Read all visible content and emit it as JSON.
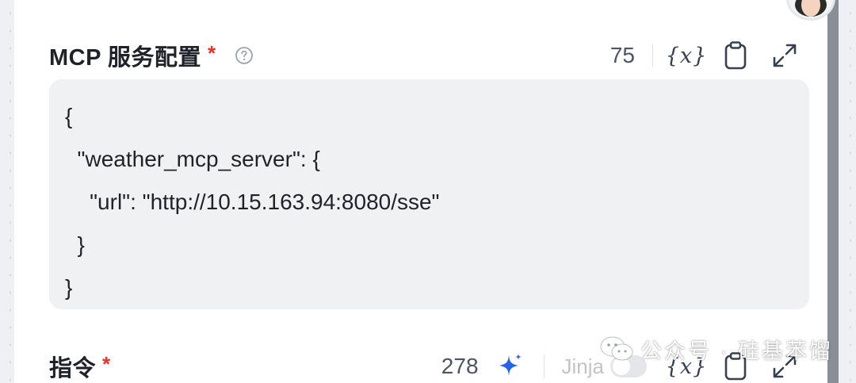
{
  "mcp_field": {
    "label": "MCP 服务配置",
    "required_mark": "*",
    "help_icon": "question-circle-icon",
    "char_count": "75",
    "tools": [
      "variable-icon",
      "clipboard-icon",
      "expand-icon"
    ],
    "code": "{\n  \"weather_mcp_server\": {\n    \"url\": \"http://10.15.163.94:8080/sse\"\n  }\n}"
  },
  "instruction_field": {
    "label": "指令",
    "required_mark": "*",
    "char_count": "278",
    "ai_icon": "sparkle-icon",
    "jinja_label": "Jinja",
    "jinja_enabled": false,
    "tools": [
      "variable-icon",
      "clipboard-icon",
      "expand-icon"
    ]
  },
  "watermark": {
    "text": "公众号 · 硅基苯馏",
    "icon": "wechat-icon"
  },
  "colors": {
    "required": "#e5342a",
    "sparkle": "#2563eb",
    "editor_bg": "#f0f1f3",
    "scrollbar": "#8a8f96"
  }
}
